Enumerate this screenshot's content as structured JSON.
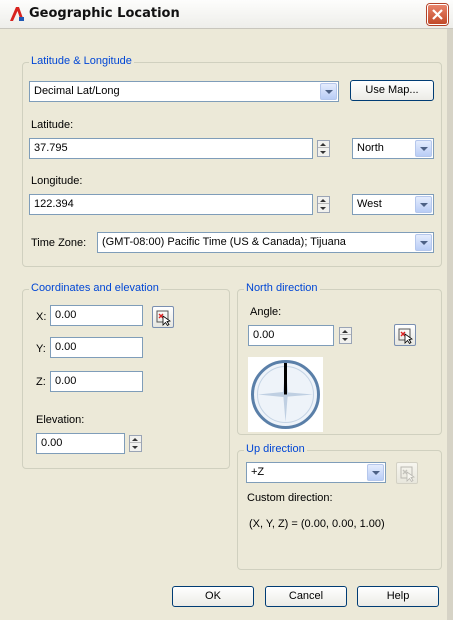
{
  "window": {
    "title": "Geographic Location",
    "app_icon": "autocad-a-icon",
    "close_icon": "close-x-icon"
  },
  "lat_long": {
    "legend": "Latitude & Longitude",
    "format_value": "Decimal Lat/Long",
    "use_map_label": "Use Map...",
    "latitude_label": "Latitude:",
    "latitude_value": "37.795",
    "latitude_dir": "North",
    "longitude_label": "Longitude:",
    "longitude_value": "122.394",
    "longitude_dir": "West",
    "time_zone_label": "Time Zone:",
    "time_zone_value": "(GMT-08:00) Pacific Time (US & Canada); Tijuana"
  },
  "coordinates": {
    "legend": "Coordinates and elevation",
    "x_label": "X:",
    "x_value": "0.00",
    "y_label": "Y:",
    "y_value": "0.00",
    "z_label": "Z:",
    "z_value": "0.00",
    "elevation_label": "Elevation:",
    "elevation_value": "0.00"
  },
  "north": {
    "legend": "North direction",
    "angle_label": "Angle:",
    "angle_value": "0.00",
    "angle_degrees": 0
  },
  "up": {
    "legend": "Up direction",
    "value": "+Z",
    "custom_label": "Custom direction:",
    "custom_value": "(X, Y, Z) = (0.00, 0.00, 1.00)"
  },
  "buttons": {
    "ok": "OK",
    "cancel": "Cancel",
    "help": "Help"
  },
  "colors": {
    "legend_text": "#0046d5",
    "dialog_bg": "#ece9d8",
    "compass_ring": "#5a7fa8"
  }
}
